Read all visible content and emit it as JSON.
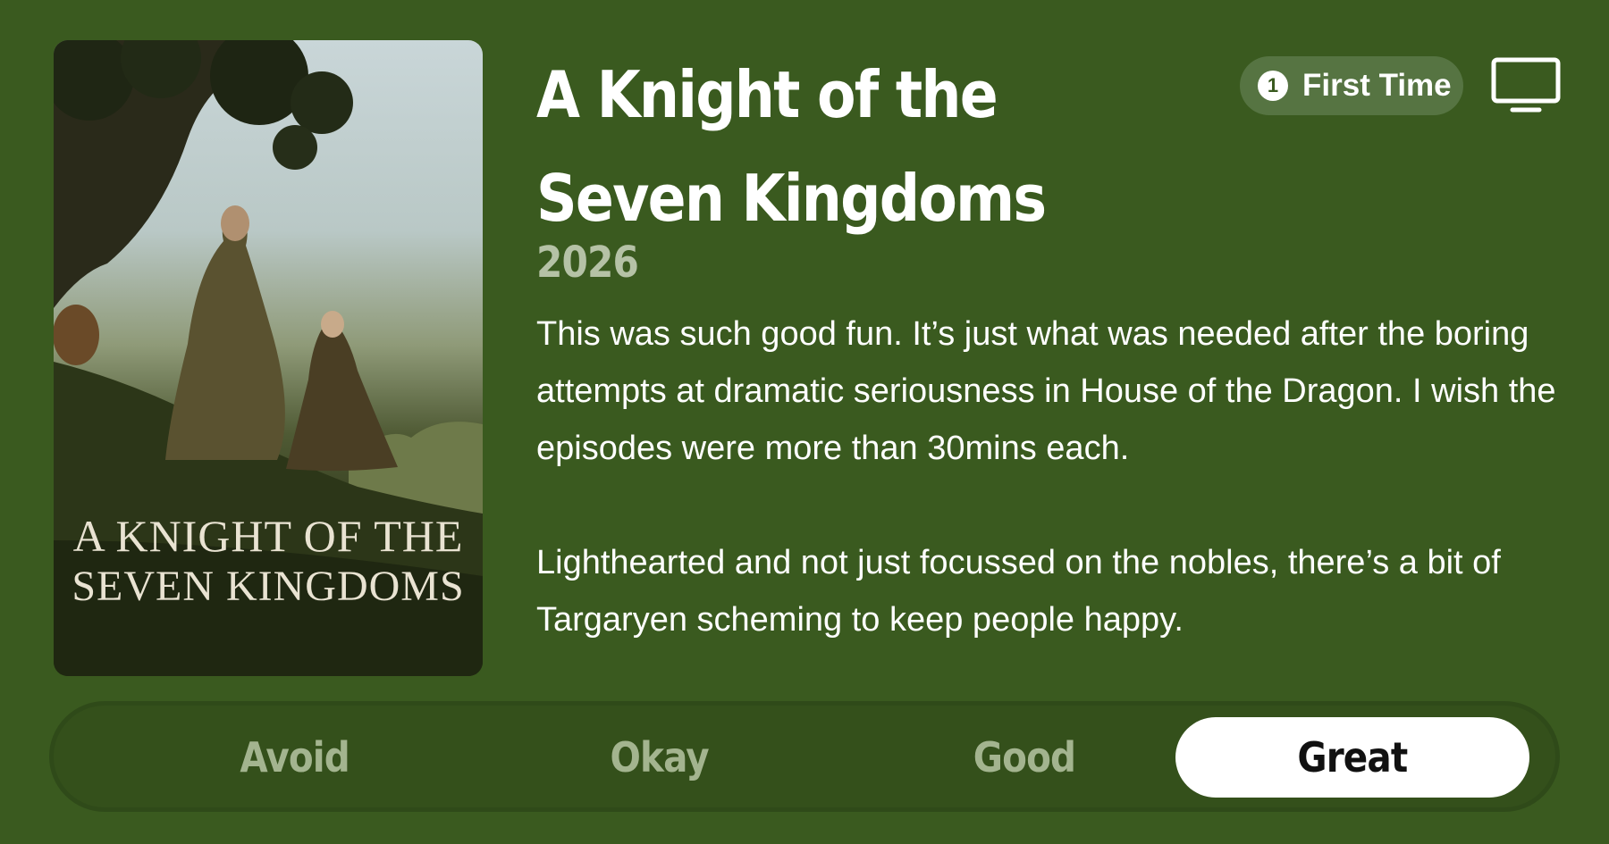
{
  "show": {
    "title": "A Knight of the Seven Kingdoms",
    "year": "2026",
    "poster": {
      "title_line1": "A KNIGHT OF THE",
      "title_line2": "SEVEN KINGDOMS"
    }
  },
  "badge": {
    "number": "1",
    "label": "First Time"
  },
  "icons": {
    "tv": "tv-icon",
    "badge_number": "number-circle-icon"
  },
  "review": {
    "paragraph1": "This was such good fun. It’s just what was needed after the boring attempts at dramatic seriousness in House of the Dragon. I wish the episodes were more than 30mins each.",
    "paragraph2": "Lighthearted and not just focussed on the nobles, there’s a bit of Targaryen scheming to keep people happy."
  },
  "rating": {
    "options": [
      "Avoid",
      "Okay",
      "Good",
      "Great"
    ],
    "selected": "Great"
  },
  "colors": {
    "background": "#3a5a1f",
    "badge": "#567442",
    "selected_segment": "#ffffff",
    "unselected_text": "#a3b48f",
    "year_text": "#b5c2a6"
  }
}
